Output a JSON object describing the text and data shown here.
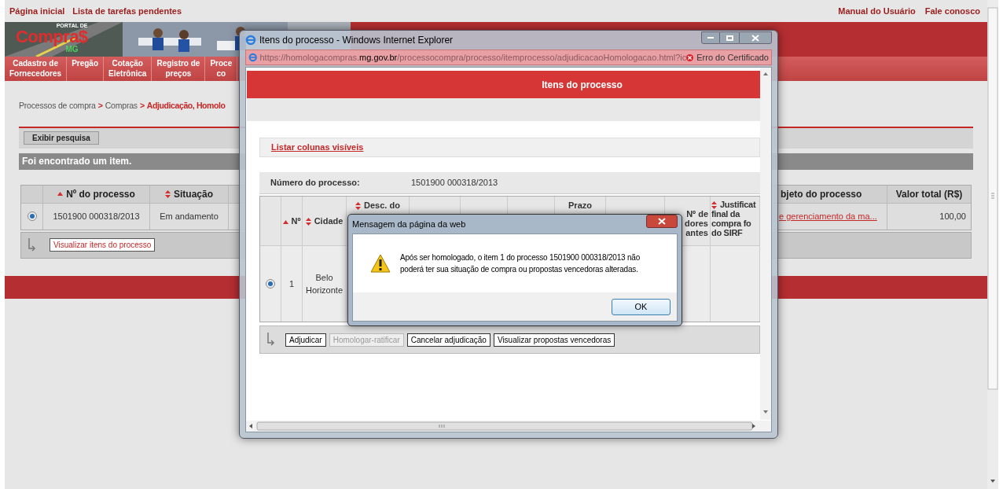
{
  "top_links": [
    "Página inicial",
    "Lista de tarefas pendentes"
  ],
  "top_right_links": [
    "Manual do Usuário",
    "Fale conosco"
  ],
  "logo": {
    "small": "PORTAL DE",
    "main": "Compra$",
    "sub": "MG"
  },
  "nav": [
    {
      "lines": [
        "Cadastro de",
        "Fornecedores"
      ]
    },
    {
      "lines": [
        "Pregão"
      ]
    },
    {
      "lines": [
        "Cotação",
        "Eletrônica"
      ]
    },
    {
      "lines": [
        "Registro de",
        "preços"
      ]
    },
    {
      "lines": [
        "Proce",
        "co"
      ]
    }
  ],
  "breadcrumb": [
    {
      "label": "Processos de compra",
      "current": false
    },
    {
      "label": "Compras",
      "current": false
    },
    {
      "label": "Adjudicação, Homolo",
      "current": true
    }
  ],
  "breadcrumb_separator": ">",
  "search_button": "Exibir pesquisa",
  "result_message": "Foi encontrado um item.",
  "table": {
    "columns": [
      {
        "label": "Nº do processo",
        "sortable": true,
        "ascending": true
      },
      {
        "label": "Situação",
        "sortable": true,
        "ascending": false
      },
      {
        "label": "bjeto do processo"
      },
      {
        "label": "Valor total (R$)"
      }
    ],
    "rows": [
      {
        "selected": true,
        "cells": [
          "1501900 000318/2013",
          "Em andamento",
          "e gerenciamento da ma...",
          "100,00"
        ]
      }
    ]
  },
  "action_button": "Visualizar itens do processo",
  "popup": {
    "title": "Itens do processo - Windows Internet Explorer",
    "url": {
      "prefix": "https://homologacompras.",
      "domain": "mg.gov.br",
      "path": "/processocompra/processo/itemprocesso/adjudicacaoHomologacao.html?ic"
    },
    "certificate_error": "Erro do Certificado",
    "header": "Itens do processo",
    "columns_link": "Listar colunas visíveis",
    "process_label": "Número do processo:",
    "process_value": "1501900 000318/2013",
    "columns": [
      {
        "lines": [
          "Nº"
        ],
        "sortable": true,
        "ascending": true
      },
      {
        "lines": [
          "Cidade"
        ],
        "sortable": true,
        "ascending": false
      },
      {
        "lines": [
          "Desc. do"
        ],
        "sortable": true,
        "ascending": false
      },
      {},
      {},
      {},
      {
        "lines": [
          "Prazo"
        ]
      },
      {},
      {
        "lines": [
          "Nº de",
          "dores",
          "antes"
        ]
      },
      {
        "lines": [
          "Justificat",
          "final da",
          "compra fo",
          "do SIRF"
        ],
        "sortable": true,
        "ascending": false
      }
    ],
    "rows": [
      {
        "selected": true,
        "cells": [
          "1",
          "Belo Horizonte"
        ]
      }
    ],
    "buttons": [
      {
        "label": "Adjudicar",
        "disabled": false
      },
      {
        "label": "Homologar-ratificar",
        "disabled": true
      },
      {
        "label": "Cancelar adjudicação",
        "disabled": false
      },
      {
        "label": "Visualizar propostas vencedoras",
        "disabled": false
      }
    ]
  },
  "dialog": {
    "title": "Mensagem da página da web",
    "message": "Após ser homologado, o item 1 do processo 1501900 000318/2013 não poderá ter sua situação de compra ou propostas vencedoras alteradas.",
    "ok": "OK"
  }
}
